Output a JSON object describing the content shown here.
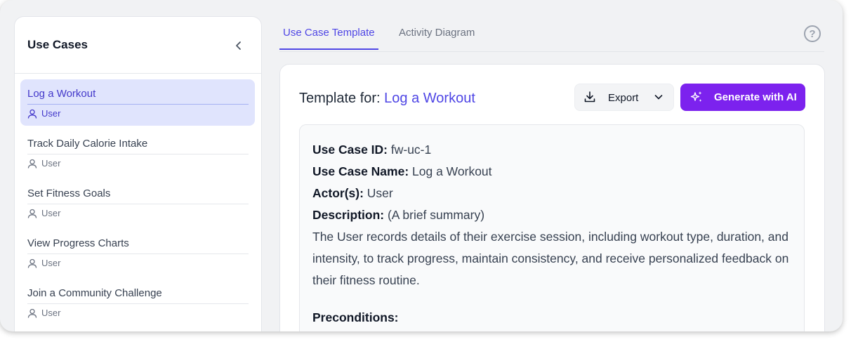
{
  "sidebar": {
    "title": "Use Cases",
    "items": [
      {
        "name": "Log a Workout",
        "actor": "User",
        "active": true
      },
      {
        "name": "Track Daily Calorie Intake",
        "actor": "User",
        "active": false
      },
      {
        "name": "Set Fitness Goals",
        "actor": "User",
        "active": false
      },
      {
        "name": "View Progress Charts",
        "actor": "User",
        "active": false
      },
      {
        "name": "Join a Community Challenge",
        "actor": "User",
        "active": false
      }
    ]
  },
  "tabs": [
    {
      "label": "Use Case Template",
      "active": true
    },
    {
      "label": "Activity Diagram",
      "active": false
    }
  ],
  "help": {
    "symbol": "?"
  },
  "card": {
    "title_prefix": "Template for:",
    "title_usecase": "Log a Workout",
    "export_label": "Export",
    "generate_label": "Generate with AI"
  },
  "template": {
    "id_label": "Use Case ID:",
    "id_value": "fw-uc-1",
    "name_label": "Use Case Name:",
    "name_value": "Log a Workout",
    "actors_label": "Actor(s):",
    "actors_value": "User",
    "description_label": "Description:",
    "description_hint": "(A brief summary)",
    "description_text": "The User records details of their exercise session, including workout type, duration, and intensity, to track progress, maintain consistency, and receive personalized feedback on their fitness routine.",
    "preconditions_label": "Preconditions:"
  },
  "colors": {
    "accent": "#4f46e5",
    "generate_button": "#7c22ee",
    "active_item_bg": "#e0e4fd"
  },
  "icons": {
    "collapse": "chevron-left-icon",
    "actor": "user-icon",
    "export": "download-icon",
    "export_menu": "chevron-down-icon",
    "generate": "sparkles-icon",
    "help": "help-circle-icon"
  }
}
